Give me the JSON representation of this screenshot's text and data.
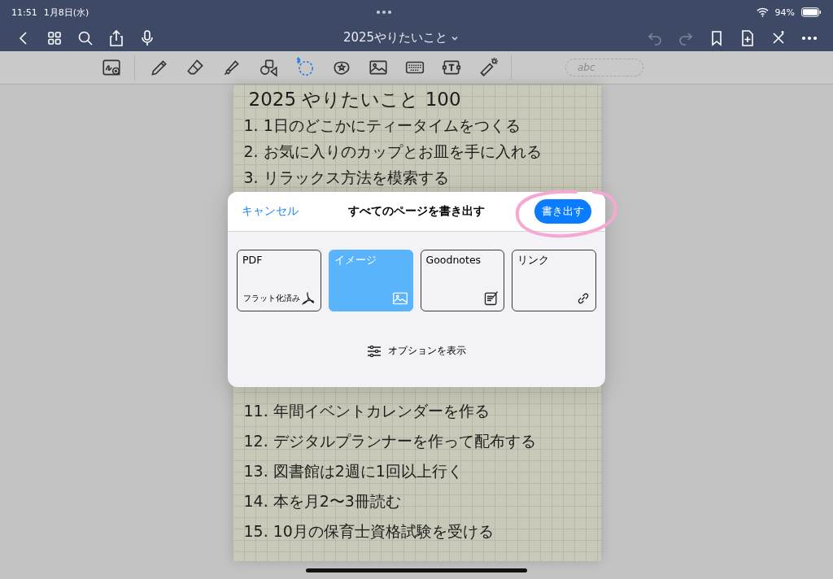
{
  "status_bar": {
    "time": "11:51",
    "date": "1月8日(水)",
    "battery": "94%"
  },
  "nav_bar": {
    "title": "2025やりたいこと"
  },
  "toolbar": {
    "tools": [
      {
        "kind": "zoom",
        "selected": false
      },
      {
        "kind": "pen",
        "selected": false
      },
      {
        "kind": "eraser",
        "selected": false
      },
      {
        "kind": "highlighter",
        "selected": false
      },
      {
        "kind": "shapes",
        "selected": false
      },
      {
        "kind": "lasso",
        "selected": true
      },
      {
        "kind": "sticker",
        "selected": false
      },
      {
        "kind": "image",
        "selected": false
      },
      {
        "kind": "keyboard",
        "selected": false
      },
      {
        "kind": "textbox",
        "selected": false
      },
      {
        "kind": "laser",
        "selected": false
      }
    ],
    "recognition_field": {
      "placeholder": "abc"
    }
  },
  "notebook": {
    "title": "2025 やりたいこと 100",
    "lines_top": [
      "1. 1日のどこかにティータイムをつくる",
      "2. お気に入りのカップとお皿を手に入れる",
      "3. リラックス方法を模索する"
    ],
    "lines_bottom": [
      "11. 年間イベントカレンダーを作る",
      "12. デジタルプランナーを作って配布する",
      "13. 図書館は2週に1回以上行く",
      "14. 本を月2〜3冊読む",
      "15. 10月の保育士資格試験を受ける"
    ]
  },
  "dialog": {
    "cancel": "キャンセル",
    "title": "すべてのページを書き出す",
    "export_button": "書き出す",
    "formats": [
      {
        "label": "PDF",
        "sublabel": "フラット化済み",
        "kind": "pdf",
        "selected": false
      },
      {
        "label": "イメージ",
        "kind": "image",
        "selected": true
      },
      {
        "label": "Goodnotes",
        "kind": "goodnotes",
        "selected": false
      },
      {
        "label": "リンク",
        "kind": "link",
        "selected": false
      }
    ],
    "options": "オプションを表示"
  }
}
